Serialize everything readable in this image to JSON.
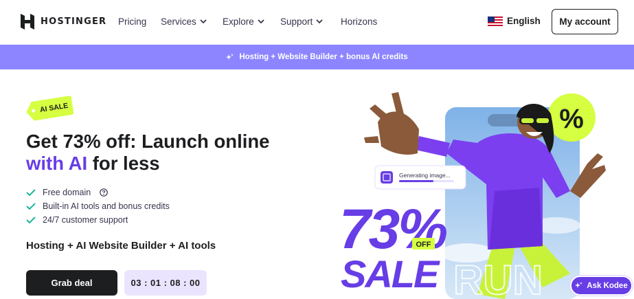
{
  "brand": {
    "name": "HOSTINGER"
  },
  "nav": {
    "items": [
      {
        "label": "Pricing",
        "has_dropdown": false
      },
      {
        "label": "Services",
        "has_dropdown": true
      },
      {
        "label": "Explore",
        "has_dropdown": true
      },
      {
        "label": "Support",
        "has_dropdown": true
      },
      {
        "label": "Horizons",
        "has_dropdown": false
      }
    ],
    "language": "English",
    "language_flag_icon": "us-flag-icon",
    "account_label": "My account"
  },
  "promo": {
    "text": "Hosting + Website Builder + bonus AI credits",
    "icon": "sparkle-icon",
    "bg": "#8c85ff"
  },
  "hero": {
    "badge": "AI SALE",
    "headline_line1": "Get 73% off: Launch online",
    "headline_accent": "with AI",
    "headline_rest": " for less",
    "features": [
      {
        "label": "Free domain",
        "has_help": true
      },
      {
        "label": "Built-in AI tools and bonus credits",
        "has_help": false
      },
      {
        "label": "24/7 customer support",
        "has_help": false
      }
    ],
    "subhead": "Hosting + AI Website Builder + AI tools",
    "cta_label": "Grab deal",
    "timer": "03 : 01 : 08 : 00"
  },
  "art": {
    "generating_label": "Generating image...",
    "sale_percent": "73%",
    "off_label": "OFF",
    "sale_word": "SALE",
    "percent_sticker": "%",
    "shirt_text": "RUN"
  },
  "chat": {
    "label": "Ask Kodee"
  },
  "colors": {
    "accent": "#673de6",
    "lime": "#d5ff40",
    "dark": "#1d1e20",
    "check": "#00b090"
  }
}
